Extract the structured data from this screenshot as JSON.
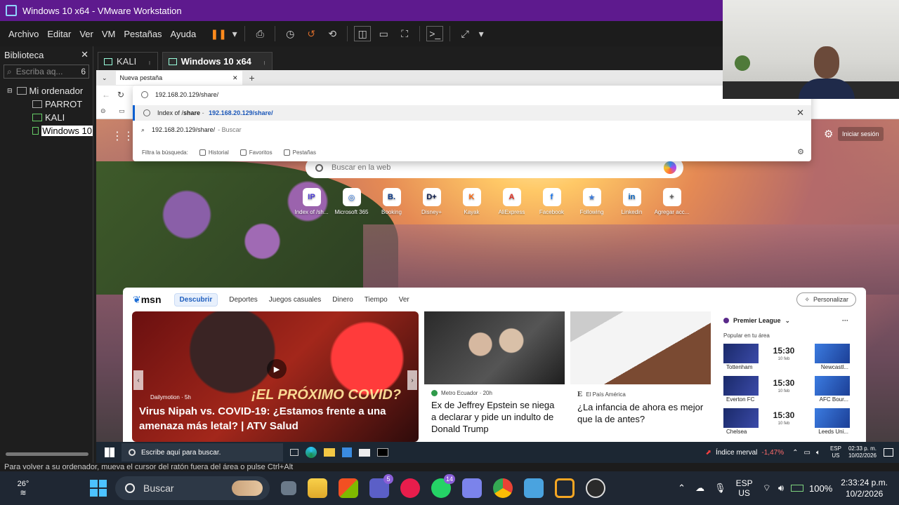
{
  "vmware": {
    "window_title": "Windows 10 x64 - VMware Workstation",
    "menu": [
      "Archivo",
      "Editar",
      "Ver",
      "VM",
      "Pestañas",
      "Ayuda"
    ],
    "library": {
      "title": "Biblioteca",
      "close": "✕",
      "search_placeholder": "Escriba aq...",
      "search_count": "6",
      "tree": [
        "Mi ordenador",
        "PARROT",
        "KALI",
        "Windows 10"
      ]
    },
    "tabs": [
      "KALI",
      "Windows 10 x64"
    ],
    "status_text": "Para volver a su ordenador, mueva el cursor del ratón fuera del área o pulse Ctrl+Alt"
  },
  "edge": {
    "tab_title": "Nueva pestaña",
    "address": "192.168.20.129/share/",
    "suggestions": {
      "url_row": "192.168.20.129/share/",
      "history_prefix": "Index of /",
      "history_bold": "share",
      "history_sep": " - ",
      "history_url": "192.168.20.129/share/",
      "search_row": "192.168.20.129/share/",
      "search_suffix": "- Buscar"
    },
    "filters_label": "Filtra la búsqueda:",
    "filters": [
      "Historial",
      "Favoritos",
      "Pestañas"
    ],
    "signin": "Iniciar sesión",
    "search_placeholder": "Buscar en la web",
    "quick_links": [
      {
        "label": "Index of /sh...",
        "glyph": "IP",
        "color": "#4a3ad8"
      },
      {
        "label": "Microsoft 365",
        "glyph": "◎",
        "color": "#2e7be8"
      },
      {
        "label": "Booking",
        "glyph": "B.",
        "color": "#0b3a8a"
      },
      {
        "label": "Disney+",
        "glyph": "D+",
        "color": "#0a1a4a"
      },
      {
        "label": "Kayak",
        "glyph": "K",
        "color": "#ff690f"
      },
      {
        "label": "AliExpress",
        "glyph": "A",
        "color": "#e43226"
      },
      {
        "label": "Facebook",
        "glyph": "f",
        "color": "#1877f2"
      },
      {
        "label": "Following",
        "glyph": "★",
        "color": "#3a7bdc"
      },
      {
        "label": "Linkedin",
        "glyph": "in",
        "color": "#0a66c2"
      },
      {
        "label": "Agregar acc...",
        "glyph": "+",
        "color": "#555555"
      }
    ]
  },
  "msn": {
    "logo": "msn",
    "nav": [
      "Descubrir",
      "Deportes",
      "Juegos casuales",
      "Dinero",
      "Tiempo",
      "Ver"
    ],
    "personalize": "Personalizar",
    "main_card": {
      "source": "Dailymotion · 5h",
      "overlay_text": "¡EL PRÓXIMO COVID?",
      "headline": "Virus Nipah vs. COVID-19: ¿Estamos frente a una amenaza más letal? | ATV Salud"
    },
    "card2": {
      "source": "Metro Ecuador · 20h",
      "title": "Ex de Jeffrey Epstein se niega a declarar y pide un indulto de Donald Trump"
    },
    "card3": {
      "source_mark": "E",
      "source": "El País América",
      "title": "¿La infancia de ahora es mejor que la de antes?"
    },
    "sports": {
      "league": "Premier League",
      "more": "···",
      "subtitle": "Popular en tu área",
      "matches": [
        {
          "home": "Tottenham",
          "time": "15:30",
          "date": "10 feb",
          "away": "Newcastl..."
        },
        {
          "home": "Everton FC",
          "time": "15:30",
          "date": "10 feb",
          "away": "AFC Bour..."
        },
        {
          "home": "Chelsea",
          "time": "15:30",
          "date": "10 feb",
          "away": "Leeds Uni..."
        }
      ]
    }
  },
  "guest_taskbar": {
    "search_placeholder": "Escribe aquí para buscar.",
    "market_label": "Índice merval",
    "market_change": "-1,47%",
    "lang_top": "ESP",
    "lang_bottom": "US",
    "time": "02:33 p. m.",
    "date": "10/02/2026"
  },
  "host_taskbar": {
    "temperature": "26°",
    "search_placeholder": "Buscar",
    "badges": {
      "teams": "5",
      "whatsapp": "14"
    },
    "lang_top": "ESP",
    "lang_bottom": "US",
    "battery": "100%",
    "time": "2:33:24 p.m.",
    "date": "10/2/2026"
  }
}
